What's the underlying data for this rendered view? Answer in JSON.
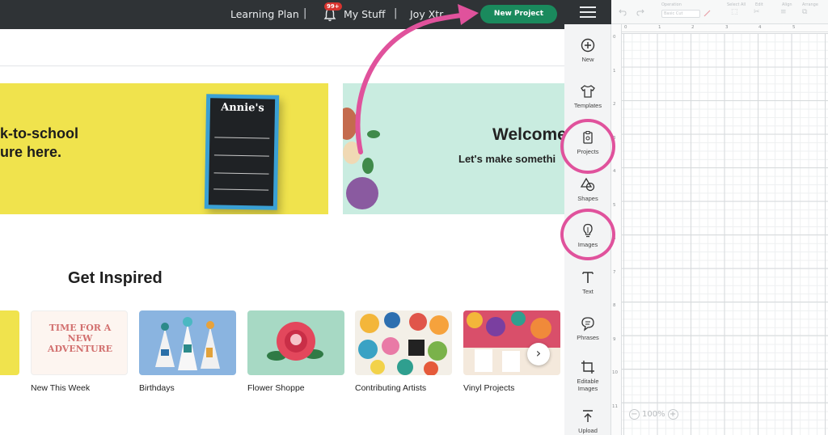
{
  "topbar": {
    "learning_plan": "Learning Plan",
    "separator": "|",
    "notification_badge": "99+",
    "my_stuff": "My Stuff",
    "user_name": "Joy Xtr",
    "new_project": "New Project"
  },
  "banner_left": {
    "line1": "k-to-school",
    "line2": "ure here.",
    "board_title": "Annie's"
  },
  "banner_right": {
    "title": "Welcome",
    "subtitle": "Let's make somethi"
  },
  "inspired": {
    "heading": "Get Inspired",
    "cards": [
      {
        "label": "New This Week",
        "art_text": "TIME FOR A NEW ADVENTURE"
      },
      {
        "label": "Birthdays"
      },
      {
        "label": "Flower Shoppe"
      },
      {
        "label": "Contributing Artists"
      },
      {
        "label": "Vinyl Projects"
      }
    ],
    "next_glyph": "›"
  },
  "sidebar": {
    "items": [
      {
        "label": "New",
        "icon": "plus-circle-icon"
      },
      {
        "label": "Templates",
        "icon": "shirt-icon"
      },
      {
        "label": "Projects",
        "icon": "clipboard-icon"
      },
      {
        "label": "Shapes",
        "icon": "shapes-icon"
      },
      {
        "label": "Images",
        "icon": "lightbulb-icon"
      },
      {
        "label": "Text",
        "icon": "text-icon"
      },
      {
        "label": "Phrases",
        "icon": "speech-bubble-icon"
      },
      {
        "label": "Editable Images",
        "icon": "crop-icon"
      },
      {
        "label": "Upload",
        "icon": "upload-icon"
      }
    ]
  },
  "toolbar": {
    "operation_label": "Operation",
    "operation_value": "Basic Cut",
    "select_all_label": "Select All",
    "edit_label": "Edit",
    "align_label": "Align",
    "arrange_label": "Arrange"
  },
  "ruler": {
    "top": [
      "0",
      "1",
      "2",
      "3",
      "4",
      "5"
    ],
    "left": [
      "0",
      "1",
      "2",
      "3",
      "4",
      "5",
      "6",
      "7",
      "8",
      "9",
      "10",
      "11"
    ]
  },
  "zoom": {
    "minus": "−",
    "value": "100%",
    "plus": "+"
  },
  "colors": {
    "accent_green": "#1a8a5d",
    "highlight_pink": "#e0529c",
    "topbar_dark": "#2f3336"
  }
}
